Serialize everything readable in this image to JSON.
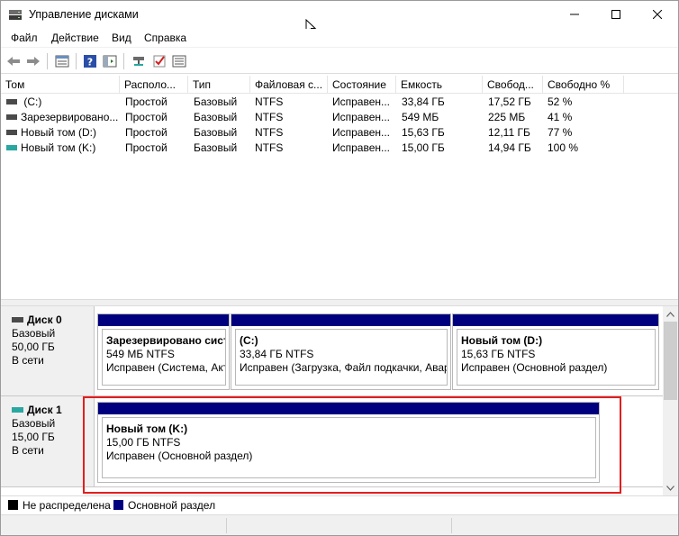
{
  "window": {
    "title": "Управление дисками",
    "icon": "disk-management-icon"
  },
  "menu": [
    {
      "label": "Файл"
    },
    {
      "label": "Действие"
    },
    {
      "label": "Вид"
    },
    {
      "label": "Справка"
    }
  ],
  "toolbar": {
    "buttons": [
      "back-arrow-icon",
      "forward-arrow-icon",
      "properties-icon",
      "help-icon",
      "console-icon",
      "connect-icon",
      "check-icon",
      "list-icon"
    ]
  },
  "volumes": {
    "columns": [
      "Том",
      "Располо...",
      "Тип",
      "Файловая с...",
      "Состояние",
      "Емкость",
      "Свобод...",
      "Свободно %"
    ],
    "rows": [
      {
        "name": " (C:)",
        "layout": "Простой",
        "type": "Базовый",
        "fs": "NTFS",
        "status": "Исправен...",
        "capacity": "33,84 ГБ",
        "free": "17,52 ГБ",
        "free_pct": "52 %",
        "icon": "hdd-icon"
      },
      {
        "name": "Зарезервировано...",
        "layout": "Простой",
        "type": "Базовый",
        "fs": "NTFS",
        "status": "Исправен...",
        "capacity": "549 МБ",
        "free": "225 МБ",
        "free_pct": "41 %",
        "icon": "hdd-icon"
      },
      {
        "name": "Новый том (D:)",
        "layout": "Простой",
        "type": "Базовый",
        "fs": "NTFS",
        "status": "Исправен...",
        "capacity": "15,63 ГБ",
        "free": "12,11 ГБ",
        "free_pct": "77 %",
        "icon": "hdd-icon"
      },
      {
        "name": "Новый том (K:)",
        "layout": "Простой",
        "type": "Базовый",
        "fs": "NTFS",
        "status": "Исправен...",
        "capacity": "15,00 ГБ",
        "free": "14,94 ГБ",
        "free_pct": "100 %",
        "icon": "usb-drive-icon"
      }
    ]
  },
  "disks": [
    {
      "name": "Диск 0",
      "type": "Базовый",
      "size": "50,00 ГБ",
      "state": "В сети",
      "partitions": [
        {
          "title": "Зарезервировано сист",
          "size": "549 МБ NTFS",
          "status": "Исправен (Система, Акт"
        },
        {
          "title": "(C:)",
          "size": "33,84 ГБ NTFS",
          "status": "Исправен (Загрузка, Файл подкачки, Авар"
        },
        {
          "title": "Новый том  (D:)",
          "size": "15,63 ГБ NTFS",
          "status": "Исправен (Основной раздел)"
        }
      ]
    },
    {
      "name": "Диск 1",
      "type": "Базовый",
      "size": "15,00 ГБ",
      "state": "В сети",
      "partitions": [
        {
          "title": "Новый том  (K:)",
          "size": "15,00 ГБ NTFS",
          "status": "Исправен (Основной раздел)"
        }
      ]
    }
  ],
  "legend": [
    {
      "label": "Не распределена",
      "color": "#000000"
    },
    {
      "label": "Основной раздел",
      "color": "#00007f"
    }
  ],
  "colors": {
    "partition_bar": "#00007f",
    "highlight": "#e31e1e"
  }
}
